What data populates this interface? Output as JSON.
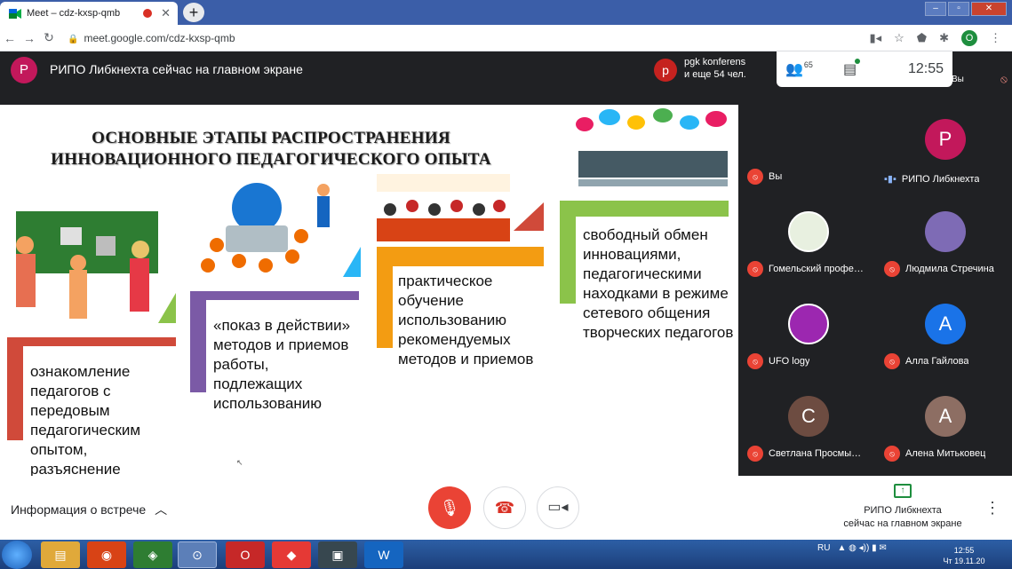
{
  "browser": {
    "tab_title": "Meet – cdz-kxsp-qmb",
    "new_tab": "+",
    "url": "meet.google.com/cdz-kxsp-qmb",
    "profile_initial": "O"
  },
  "meet_header": {
    "presenter_initial": "P",
    "presenter_text": "РИПО Либкнехта сейчас на главном экране",
    "pinned_initial": "p",
    "pinned_line1": "pgk konferens",
    "pinned_line2": "и еще 54 чел.",
    "people_count": "65",
    "time": "12:55",
    "self_label": "Вы"
  },
  "slide": {
    "title_line1": "ОСНОВНЫЕ ЭТАПЫ РАСПРОСТРАНЕНИЯ",
    "title_line2": "ИННОВАЦИОННОГО ПЕДАГОГИЧЕСКОГО ОПЫТА",
    "steps": [
      {
        "text": "ознакомление педагогов с передовым педагогическим опытом, разъяснение",
        "color": "#d04a3a"
      },
      {
        "text": "«показ в действии» методов и приемов работы, подлежащих использованию",
        "color": "#7b5aa6"
      },
      {
        "text": "практическое обучение использованию рекомендуемых методов и приемов",
        "color": "#f39c12"
      },
      {
        "text": "свободный обмен инновациями, педагогическими находками в режиме сетевого общения творческих педагогов",
        "color": "#8bc34a"
      }
    ]
  },
  "participants": [
    {
      "name": "Вы",
      "initial": "",
      "color": "#202124",
      "muted": true
    },
    {
      "name": "РИПО Либкнехта",
      "initial": "P",
      "color": "#c2185b",
      "muted": false
    },
    {
      "name": "Гомельский профе…",
      "initial": "",
      "color": "#e8f0e0",
      "muted": true
    },
    {
      "name": "Людмила Стречина",
      "initial": "",
      "color": "#7e6bb5",
      "muted": true
    },
    {
      "name": "UFO logy",
      "initial": "",
      "color": "#9c27b0",
      "muted": true
    },
    {
      "name": "Алла Гайлова",
      "initial": "A",
      "color": "#1a73e8",
      "muted": true
    },
    {
      "name": "Светлана Просмы…",
      "initial": "C",
      "color": "#6d4c41",
      "muted": true
    },
    {
      "name": "Алена Митьковец",
      "initial": "A",
      "color": "#8d6e63",
      "muted": true
    }
  ],
  "bottom_bar": {
    "meeting_info": "Информация о встрече",
    "presenting_line1": "РИПО Либкнехта",
    "presenting_line2": "сейчас на главном экране"
  },
  "taskbar": {
    "lang": "RU",
    "time": "12:55",
    "date": "Чт 19.11.20"
  }
}
